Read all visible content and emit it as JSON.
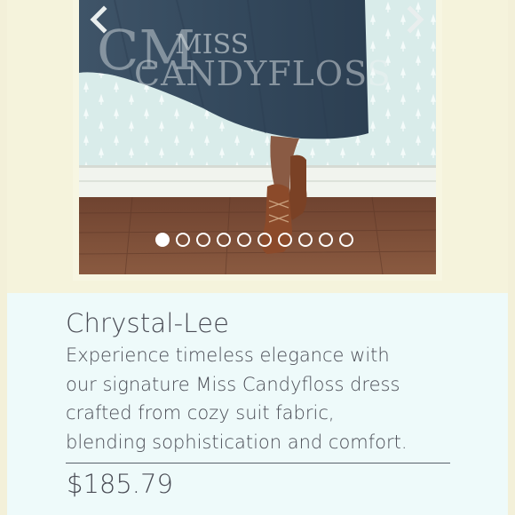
{
  "product": {
    "title": "Chrystal-Lee",
    "description": "Experience timeless elegance with\nour signature Miss Candyfloss dress\ncrafted from cozy suit fabric,\nblending  sophistication and comfort.",
    "price": "$185.79"
  },
  "gallery": {
    "watermark_line1": "MISS",
    "watermark_line2": "CANDYFLOSS",
    "watermark_initials": "CM",
    "prev_icon": "chevron-left-icon",
    "next_icon": "chevron-right-icon",
    "image_count": 10,
    "active_index": 0
  },
  "colors": {
    "frame": "#f5f3dc",
    "background": "#eefafa",
    "text": "#4a4c55",
    "skirt": "#3b4f63",
    "floor": "#7a4a33",
    "wall": "#d8ebe9"
  }
}
